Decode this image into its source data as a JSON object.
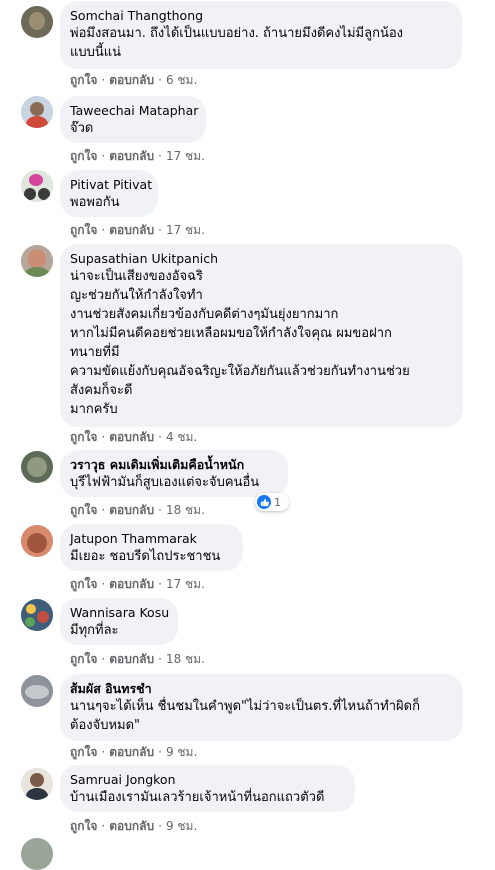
{
  "actions": {
    "like": "ถูกใจ",
    "reply": "ตอบกลับ",
    "separator": "·"
  },
  "comments": [
    {
      "author": "Somchai Thangthong",
      "lines": [
        "พ่อมึงสอนมา. ถึงได้เป็นแบบอย่าง. ถ้านายมึงดีคงไม่มีลูกน้อง",
        "แบบนี้แน่"
      ],
      "time": "6 ชม."
    },
    {
      "author": "Taweechai Mataphar",
      "lines": [
        "จ๊วด"
      ],
      "time": "17 ชม."
    },
    {
      "author": "Pitivat Pitivat",
      "lines": [
        "พอพอกัน"
      ],
      "time": "17 ชม."
    },
    {
      "author": "Supasathian Ukitpanich",
      "lines": [
        "น่าจะเป็นเสียงของอัจฉริ",
        "ญะช่วยกันให้กำลังใจทำ",
        "งานช่วยสังคมเกี่ยวข้องกับคดีต่างๆมันยุ่งยากมาก",
        "หากไม่มีคนดีคอยช่วยเหลือผมขอให้กำลังใจคุณ ผมขอฝาก",
        "ทนายที่มี",
        "ความขัดแย้งกับคุณอัจฉริญะให้อภัยกันแล้วช่วยกันทำงานช่วย",
        "สังคมก็จะดี",
        "มากครับ"
      ],
      "time": "4 ชม."
    },
    {
      "author": "วราวุธ คมเดิมเพิ่มเติมคือน้ำหนัก",
      "lines": [
        "บุรีไฟฟ้ามันก็สูบเองแต่จะจับคนอื่น"
      ],
      "time": "18 ชม.",
      "reaction_count": "1"
    },
    {
      "author": "Jatupon Thammarak",
      "lines": [
        "มีเยอะ ชอบรีดไถประชาชน"
      ],
      "time": "17 ชม."
    },
    {
      "author": "Wannisara Kosu",
      "lines": [
        "มีทุกที่ละ"
      ],
      "time": "18 ชม."
    },
    {
      "author": "ส้มผัส อินทรชำ",
      "lines": [
        "นานๆจะได้เห็น ชื่นชมในคำพูด\"ไม่ว่าจะเป็นตร.ที่ไหนถ้าทำผิดก็",
        "ต้องจับหมด\""
      ],
      "time": "9 ชม."
    },
    {
      "author": "Samruai Jongkon",
      "lines": [
        "บ้านเมืองเรามันเลวร้ายเจ้าหน้าที่นอกแถวตัวดี"
      ],
      "time": "9 ชม."
    }
  ]
}
